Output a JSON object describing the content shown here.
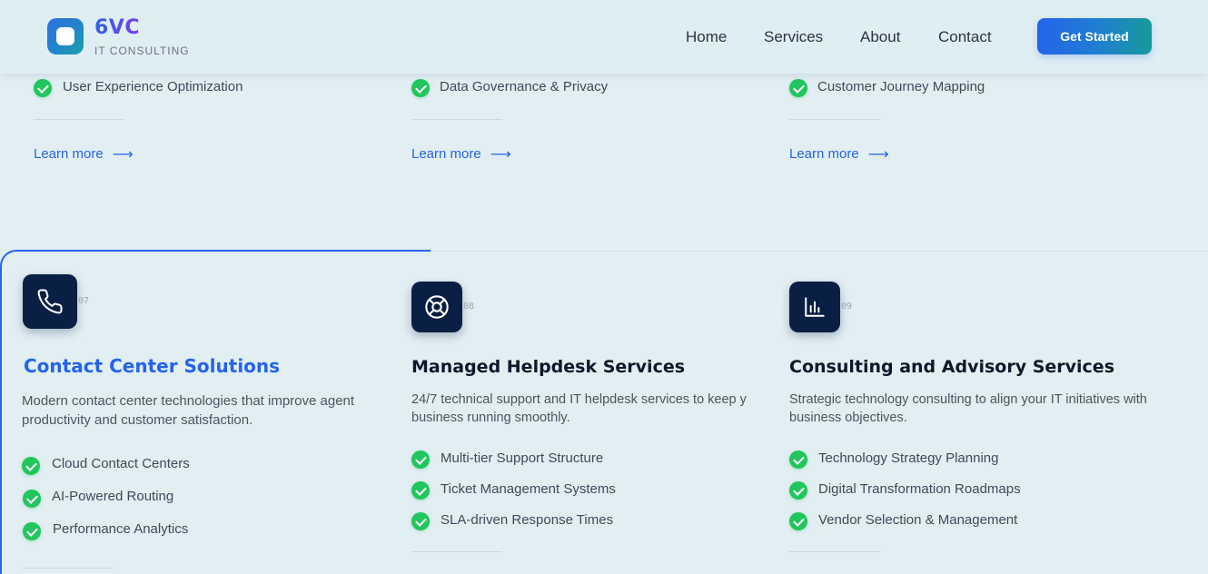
{
  "header": {
    "logo_name": "6VC",
    "logo_tagline": "IT CONSULTING",
    "nav": [
      "Home",
      "Services",
      "About",
      "Contact"
    ],
    "cta": "Get Started"
  },
  "upper_cards": [
    {
      "feature": "User Experience Optimization",
      "link": "Learn more"
    },
    {
      "feature": "Data Governance & Privacy",
      "link": "Learn more"
    },
    {
      "feature": "Customer Journey Mapping",
      "link": "Learn more"
    }
  ],
  "services": [
    {
      "number": "07",
      "icon": "phone-icon",
      "title": "Contact Center Solutions",
      "description": "Modern contact center technologies that improve agent productivity and customer satisfaction.",
      "features": [
        "Cloud Contact Centers",
        "AI-Powered Routing",
        "Performance Analytics"
      ]
    },
    {
      "number": "08",
      "icon": "lifebuoy-icon",
      "title": "Managed Helpdesk Services",
      "description": "24/7 technical support and IT helpdesk services to keep y business running smoothly.",
      "features": [
        "Multi-tier Support Structure",
        "Ticket Management Systems",
        "SLA-driven Response Times"
      ]
    },
    {
      "number": "09",
      "icon": "bar-chart-icon",
      "title": "Consulting and Advisory Services",
      "description": "Strategic technology consulting to align your IT initiatives with business objectives.",
      "features": [
        "Technology Strategy Planning",
        "Digital Transformation Roadmaps",
        "Vendor Selection & Management"
      ]
    }
  ],
  "colors": {
    "accent": "#2563eb",
    "check": "#22c55e",
    "icon_tile": "#0a1f44",
    "background": "#e1eef2"
  }
}
